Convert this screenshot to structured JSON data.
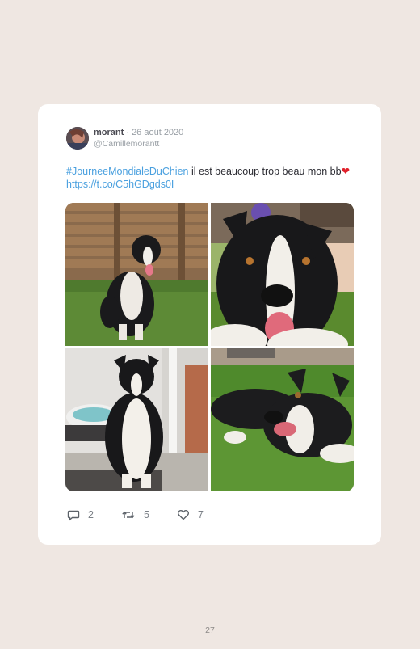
{
  "tweet": {
    "author_name": "morant",
    "separator": " · ",
    "date": "26 août 2020",
    "handle": "@Camillemorantt",
    "hashtag": "#JourneeMondialeDuChien",
    "text": " il est beaucoup trop beau mon bb",
    "emoji": "❤",
    "link": "https://t.co/C5hGDgds0I",
    "images": [
      {
        "icon": "dog-photo-garden-fence"
      },
      {
        "icon": "dog-photo-closeup"
      },
      {
        "icon": "dog-photo-indoors-bed"
      },
      {
        "icon": "dog-photo-lying-grass"
      }
    ],
    "actions": {
      "reply_count": "2",
      "retweet_count": "5",
      "like_count": "7"
    }
  },
  "page": {
    "number": "27"
  },
  "colors": {
    "background": "#efe7e2",
    "card": "#ffffff",
    "link": "#4aa0df",
    "heart": "#e0212b"
  }
}
